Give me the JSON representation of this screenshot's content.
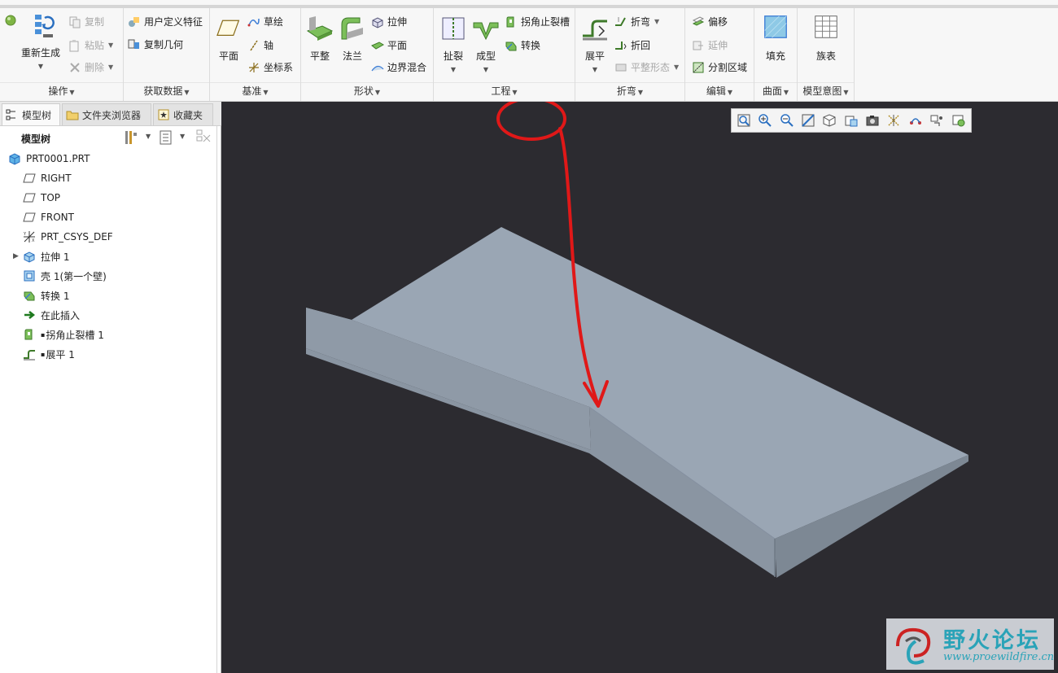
{
  "ribbon": {
    "ops": {
      "regenerate": "重新生成",
      "copy": "复制",
      "paste": "粘贴",
      "delete": "删除",
      "label": "操作"
    },
    "getdata": {
      "udf": "用户定义特征",
      "copygeom": "复制几何",
      "label": "获取数据"
    },
    "datum": {
      "plane": "平面",
      "sketch": "草绘",
      "axis": "轴",
      "csys": "坐标系",
      "label": "基准"
    },
    "shapes": {
      "flat": "平整",
      "flange": "法兰",
      "extrude": "拉伸",
      "plane": "平面",
      "boundary": "边界混合",
      "label": "形状"
    },
    "eng": {
      "rip": "扯裂",
      "form": "成型",
      "corner_relief": "拐角止裂槽",
      "convert": "转换",
      "label": "工程"
    },
    "bend": {
      "unbend": "展平",
      "bend": "折弯",
      "bendback": "折回",
      "flatform": "平整形态",
      "label": "折弯"
    },
    "edit": {
      "offset": "偏移",
      "extend": "延伸",
      "split": "分割区域",
      "label": "编辑"
    },
    "surface": {
      "fill": "填充",
      "label": "曲面"
    },
    "intent": {
      "family": "族表",
      "label": "模型意图"
    }
  },
  "tabs": {
    "model_tree": "模型树",
    "folder_browser": "文件夹浏览器",
    "favorites": "收藏夹"
  },
  "tree": {
    "header": "模型树",
    "items": [
      "PRT0001.PRT",
      "RIGHT",
      "TOP",
      "FRONT",
      "PRT_CSYS_DEF",
      "拉伸 1",
      "壳 1(第一个壁)",
      "转换 1",
      "在此插入",
      "拐角止裂槽 1",
      "展平 1"
    ]
  },
  "watermark": {
    "title": "野火论坛",
    "url": "www.proewildfire.cn"
  },
  "colors": {
    "viewport_bg": "#2c2b30",
    "part_top": "#9aa6b4",
    "annotation_red": "#e01818",
    "brand": "#2aa3b8"
  }
}
